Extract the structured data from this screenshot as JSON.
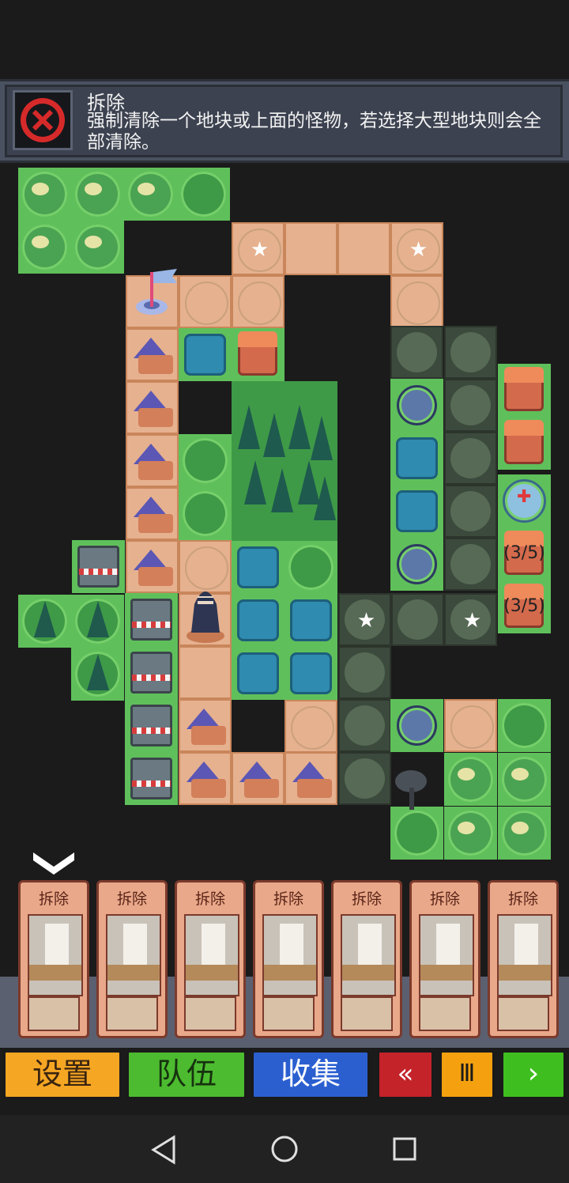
{
  "tooltip": {
    "title": "拆除",
    "description": "强制清除一个地块或上面的怪物，若选择大型地块则会全部清除。",
    "icon": "remove-x-icon"
  },
  "map": {
    "camps": [
      {
        "counter": "(3/5)"
      },
      {
        "counter": "(3/5)"
      }
    ]
  },
  "hand": {
    "cards": [
      {
        "label": "拆除"
      },
      {
        "label": "拆除"
      },
      {
        "label": "拆除"
      },
      {
        "label": "拆除"
      },
      {
        "label": "拆除"
      },
      {
        "label": "拆除"
      },
      {
        "label": "拆除"
      }
    ]
  },
  "toolbar": {
    "settings": "设置",
    "team": "队伍",
    "collect": "收集",
    "rewind": "«",
    "pause": "Ⅲ",
    "play": "›"
  },
  "colors": {
    "settings": "#f5a623",
    "team": "#4cbb2f",
    "collect": "#2b5fd0",
    "rewind": "#c4232a",
    "pause": "#f5a10f",
    "play": "#3fbf1f"
  }
}
